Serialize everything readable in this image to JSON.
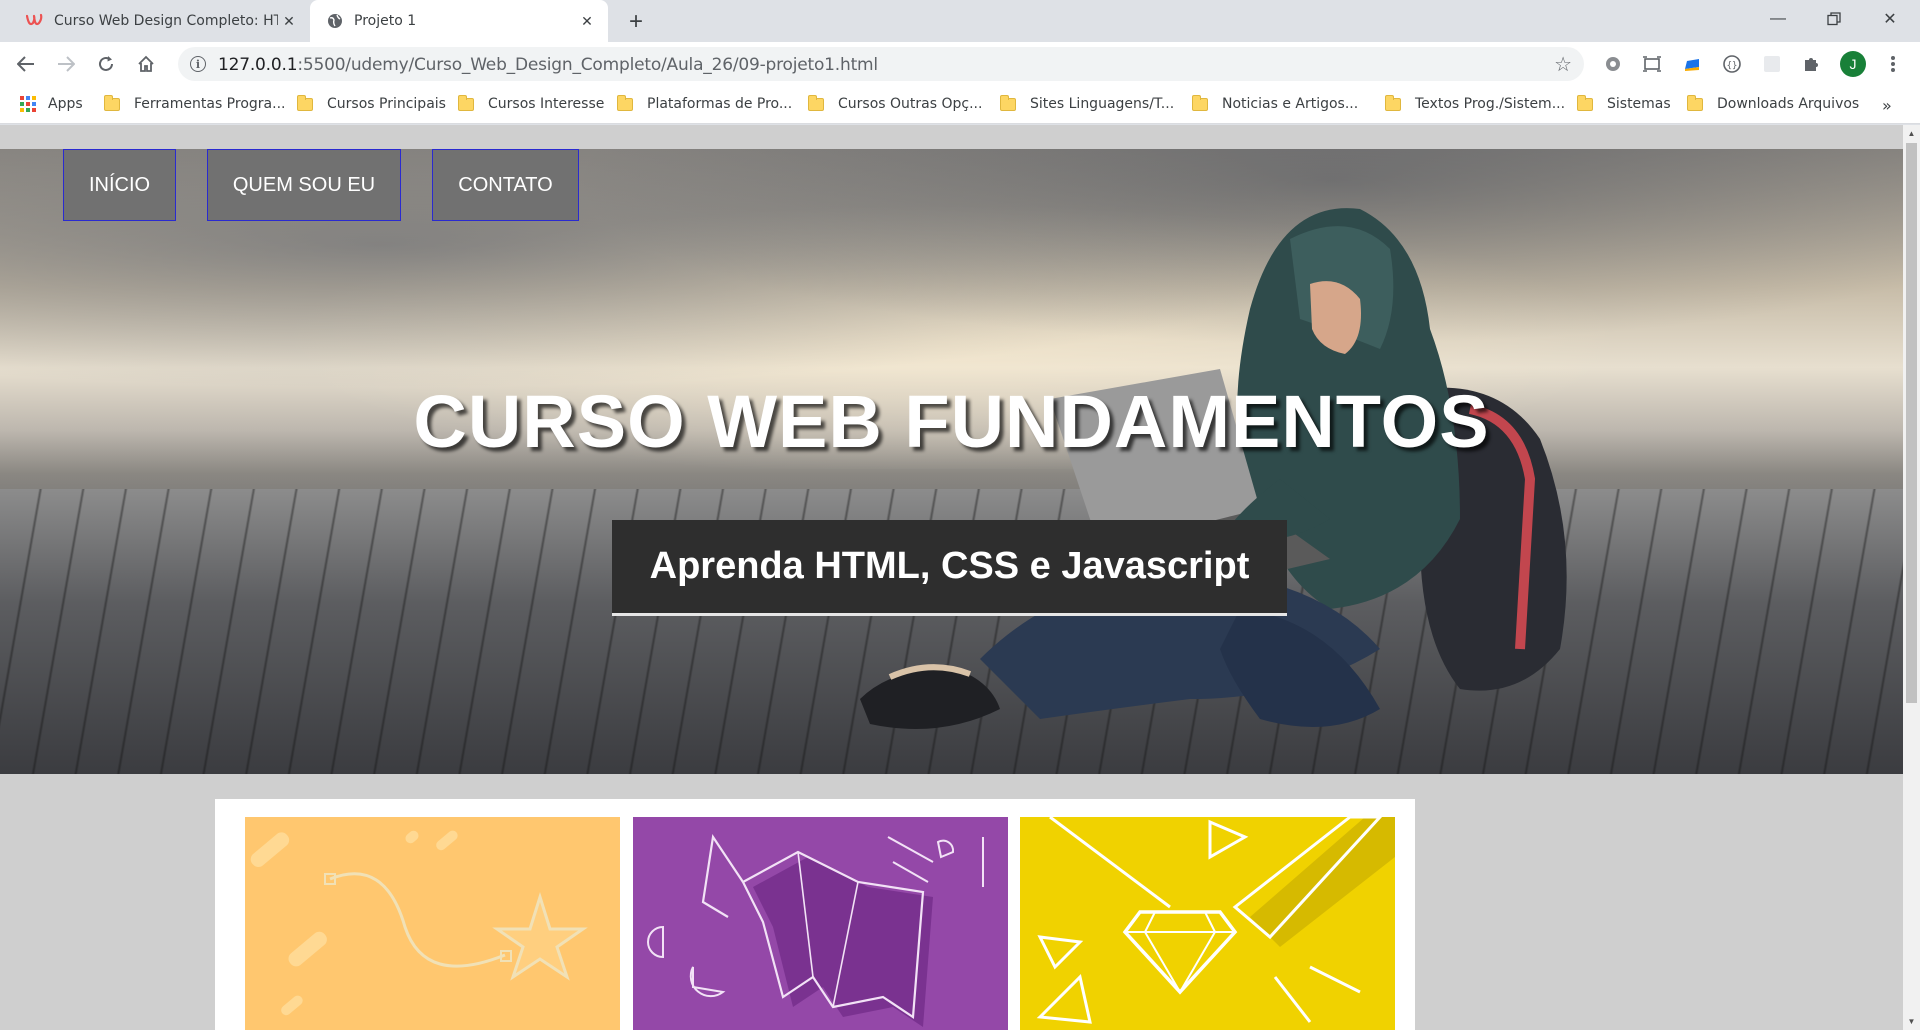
{
  "browser": {
    "tabs": [
      {
        "title": "Curso Web Design Completo: HT",
        "favicon": "udemy-icon",
        "active": false
      },
      {
        "title": "Projeto 1",
        "favicon": "globe-icon",
        "active": true
      }
    ],
    "address": {
      "host": "127.0.0.1",
      "path": ":5500/udemy/Curso_Web_Design_Completo/Aula_26/09-projeto1.html"
    },
    "profile_initial": "J",
    "bookmarks": [
      "Apps",
      "Ferramentas Progra...",
      "Cursos Principais",
      "Cursos Interesse",
      "Plataformas de Pro...",
      "Cursos Outras Opç...",
      "Sites Linguagens/T...",
      "Noticias e Artigos...",
      "Textos Prog./Sistem...",
      "Sistemas",
      "Downloads Arquivos"
    ],
    "more_bookmarks": "»"
  },
  "page": {
    "nav": [
      "INÍCIO",
      "QUEM SOU EU",
      "CONTATO"
    ],
    "hero_title": "CURSO WEB FUNDAMENTOS",
    "hero_subtitle": "Aprenda HTML, CSS e Javascript",
    "cards": [
      {
        "color": "#ffc76f",
        "icon": "curve-star-illustration"
      },
      {
        "color": "#9448a8",
        "icon": "origami-elephant-illustration"
      },
      {
        "color": "#f0d200",
        "icon": "diamond-pencil-illustration"
      }
    ]
  },
  "colors": {
    "nav_bg": "#707070",
    "nav_border": "#2a2ad0",
    "subtitle_bg": "#2e2e2e",
    "page_bg": "#cfcfcf"
  }
}
